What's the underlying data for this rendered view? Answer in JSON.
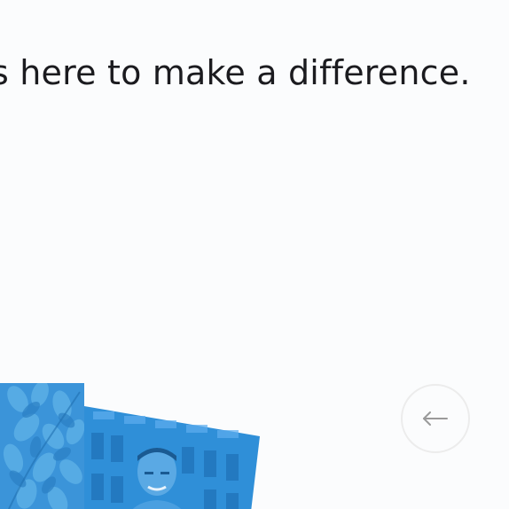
{
  "hero": {
    "headline": "s here to make a difference."
  },
  "gallery": {
    "images": [
      {
        "name": "foliage-photo",
        "tint": "#2f8fd8"
      },
      {
        "name": "person-photo",
        "tint": "#2f8fd8"
      }
    ]
  },
  "navigation": {
    "prev_icon": "arrow-left-icon",
    "icon_color": "#9a9a9a",
    "border_color": "#ececec"
  },
  "colors": {
    "background": "#fbfcfd",
    "text": "#1b1b1f",
    "image_tint": "#2f8fd8"
  }
}
